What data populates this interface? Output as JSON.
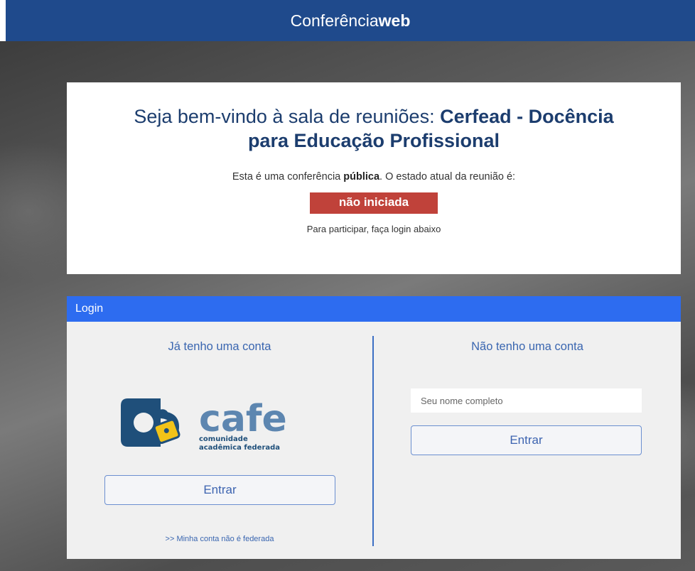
{
  "header": {
    "brand_light": "Conferência",
    "brand_bold": "web"
  },
  "welcome": {
    "title_prefix": "Seja bem-vindo à sala de reuniões:",
    "room_name": "Cerfead - Docência para Educação Profissional",
    "status_prefix": "Esta é uma conferência",
    "status_type": "pública",
    "status_suffix": ". O estado atual da reunião é:",
    "meeting_status": "não iniciada",
    "hint": "Para participar, faça login abaixo"
  },
  "login": {
    "header": "Login",
    "has_account": {
      "title": "Já tenho uma conta",
      "logo_word": "cafe",
      "logo_sub1": "comunidade",
      "logo_sub2": "acadêmica federada",
      "button": "Entrar",
      "link": ">> Minha conta não é federada"
    },
    "no_account": {
      "title": "Não tenho uma conta",
      "name_placeholder": "Seu nome completo",
      "name_value": "",
      "button": "Entrar"
    }
  },
  "colors": {
    "topbar": "#1f4a8c",
    "login_header": "#2d6cf0",
    "status_badge": "#c0423a",
    "cafe_blue": "#1f4f7a",
    "cafe_yellow": "#f2c318"
  }
}
